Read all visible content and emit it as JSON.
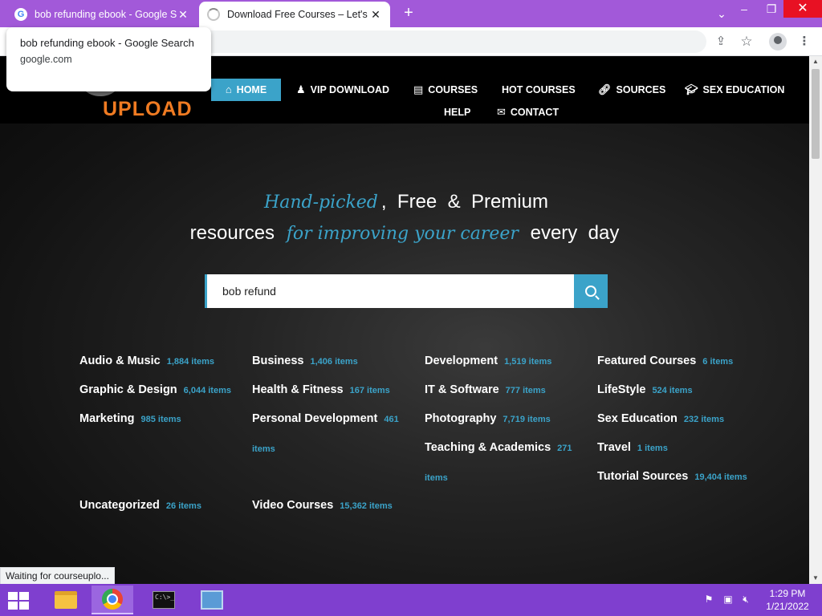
{
  "browser": {
    "tabs": [
      {
        "label": "bob refunding ebook - Google S",
        "favicon": "G"
      },
      {
        "label": "Download Free Courses – Let's st"
      }
    ],
    "new_tab": "+",
    "tooltip": {
      "title": "bob refunding ebook - Google Search",
      "url": "google.com"
    },
    "status": "Waiting for courseuplo..."
  },
  "site": {
    "logo_text": "UPLOAD",
    "nav": {
      "home": "HOME",
      "vip": "VIP DOWNLOAD",
      "courses": "COURSES",
      "hot": "HOT COURSES",
      "sources": "SOURCES",
      "sex": "SEX EDUCATION",
      "help": "HELP",
      "contact": "CONTACT"
    },
    "hero": {
      "part1_script": "Hand-picked",
      "part1_rest": ",  Free  &  Premium",
      "part2_a": "resources",
      "part2_script": "for improving your career",
      "part2_b": "every  day"
    },
    "search": {
      "value": "bob refund"
    },
    "categories": [
      {
        "name": "Audio & Music",
        "count": "1,884 items"
      },
      {
        "name": "Business",
        "count": "1,406 items"
      },
      {
        "name": "Development",
        "count": "1,519 items"
      },
      {
        "name": "Featured Courses",
        "count": "6 items"
      },
      {
        "name": "Graphic & Design",
        "count": "6,044 items"
      },
      {
        "name": "Health & Fitness",
        "count": "167 items"
      },
      {
        "name": "IT & Software",
        "count": "777 items"
      },
      {
        "name": "LifeStyle",
        "count": "524 items"
      },
      {
        "name": "Marketing",
        "count": "985 items"
      },
      {
        "name": "Personal Development",
        "count": "461 items"
      },
      {
        "name": "Photography",
        "count": "7,719 items"
      },
      {
        "name": "Sex Education",
        "count": "232 items"
      },
      {
        "name": "Teaching & Academics",
        "count": "271 items"
      },
      {
        "name": "Travel",
        "count": "1 items"
      },
      {
        "name": "Tutorial Sources",
        "count": "19,404 items"
      },
      {
        "name": "Uncategorized",
        "count": "26 items"
      },
      {
        "name": "Video Courses",
        "count": "15,362 items"
      }
    ]
  },
  "taskbar": {
    "time": "1:29 PM",
    "date": "1/21/2022",
    "cmd_text": "C:\\>_"
  },
  "colors": {
    "accent": "#3ba3c9",
    "logo": "#f07b22",
    "titlebar": "#a259d9",
    "taskbar": "#7f3fcf"
  }
}
